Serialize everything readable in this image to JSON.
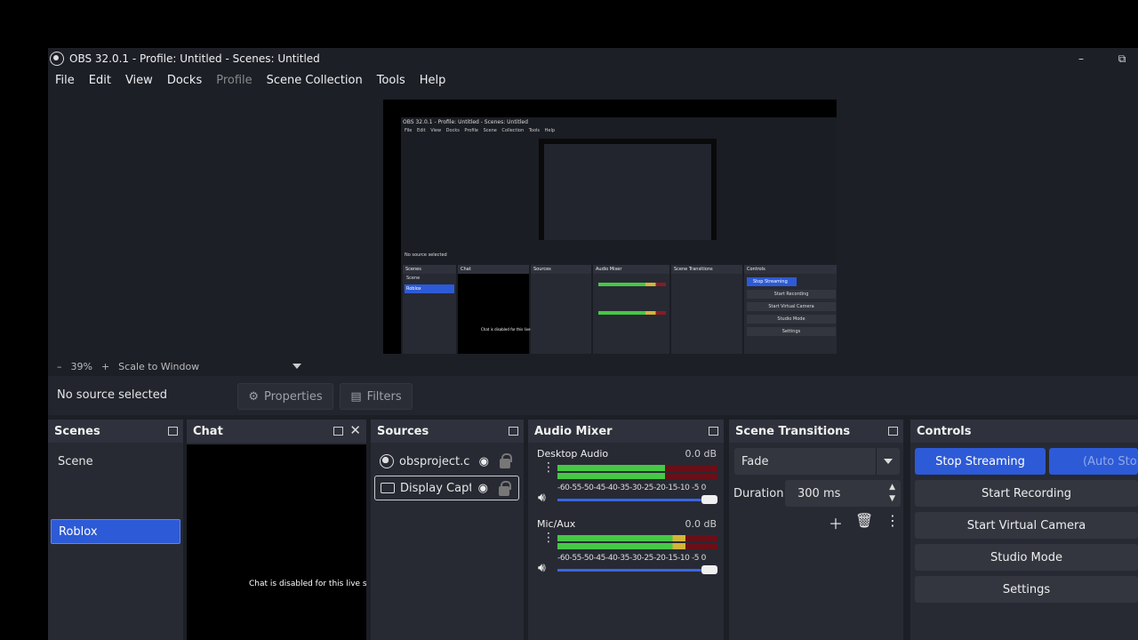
{
  "window": {
    "title": "OBS 32.0.1 - Profile: Untitled - Scenes: Untitled",
    "minimize": "–",
    "restore": "⧉"
  },
  "menu": [
    "File",
    "Edit",
    "View",
    "Docks",
    "Profile",
    "Scene Collection",
    "Tools",
    "Help"
  ],
  "preview": {
    "mini_title": "OBS 32.0.1 - Profile: Untitled - Scenes: Untitled",
    "mini_menu": "File Edit View Docks Profile Scene Collection Tools Help",
    "mini_nosrc": "No source selected",
    "mini_scene1": "Scene",
    "mini_scene2": "Roblox",
    "mini_stop": "Stop Streaming",
    "mini_rec": "Start Recording",
    "mini_vcam": "Start Virtual Camera",
    "mini_studio": "Studio Mode",
    "mini_settings": "Settings",
    "mini_chat": "Chat is disabled for this live st"
  },
  "zoom": {
    "minus": "–",
    "value": "39%",
    "plus": "+",
    "mode": "Scale to Window"
  },
  "sourcebar": {
    "status": "No source selected",
    "properties": "Properties",
    "filters": "Filters"
  },
  "scenes": {
    "title": "Scenes",
    "items": [
      "Scene",
      "Roblox"
    ]
  },
  "chat": {
    "title": "Chat",
    "message": "Chat is disabled for this live st"
  },
  "sources": {
    "title": "Sources",
    "items": [
      "obsproject.cc",
      "Display Captu"
    ]
  },
  "mixer": {
    "title": "Audio Mixer",
    "ticks": "-60-55-50-45-40-35-30-25-20-15-10 -5  0",
    "channels": [
      {
        "name": "Desktop Audio",
        "db": "0.0 dB",
        "level": 0.67
      },
      {
        "name": "Mic/Aux",
        "db": "0.0 dB",
        "level": 0.8
      }
    ]
  },
  "transitions": {
    "title": "Scene Transitions",
    "selected": "Fade",
    "duration_label": "Duration",
    "duration_value": "300 ms"
  },
  "controls": {
    "title": "Controls",
    "stop_streaming": "Stop Streaming",
    "auto_stop": "(Auto Stop",
    "start_recording": "Start Recording",
    "start_virtual_camera": "Start Virtual Camera",
    "studio_mode": "Studio Mode",
    "settings": "Settings"
  },
  "colors": {
    "accent": "#2d5ad6",
    "panel": "#272a33",
    "header": "#2f323c",
    "background": "#1d1f27"
  }
}
